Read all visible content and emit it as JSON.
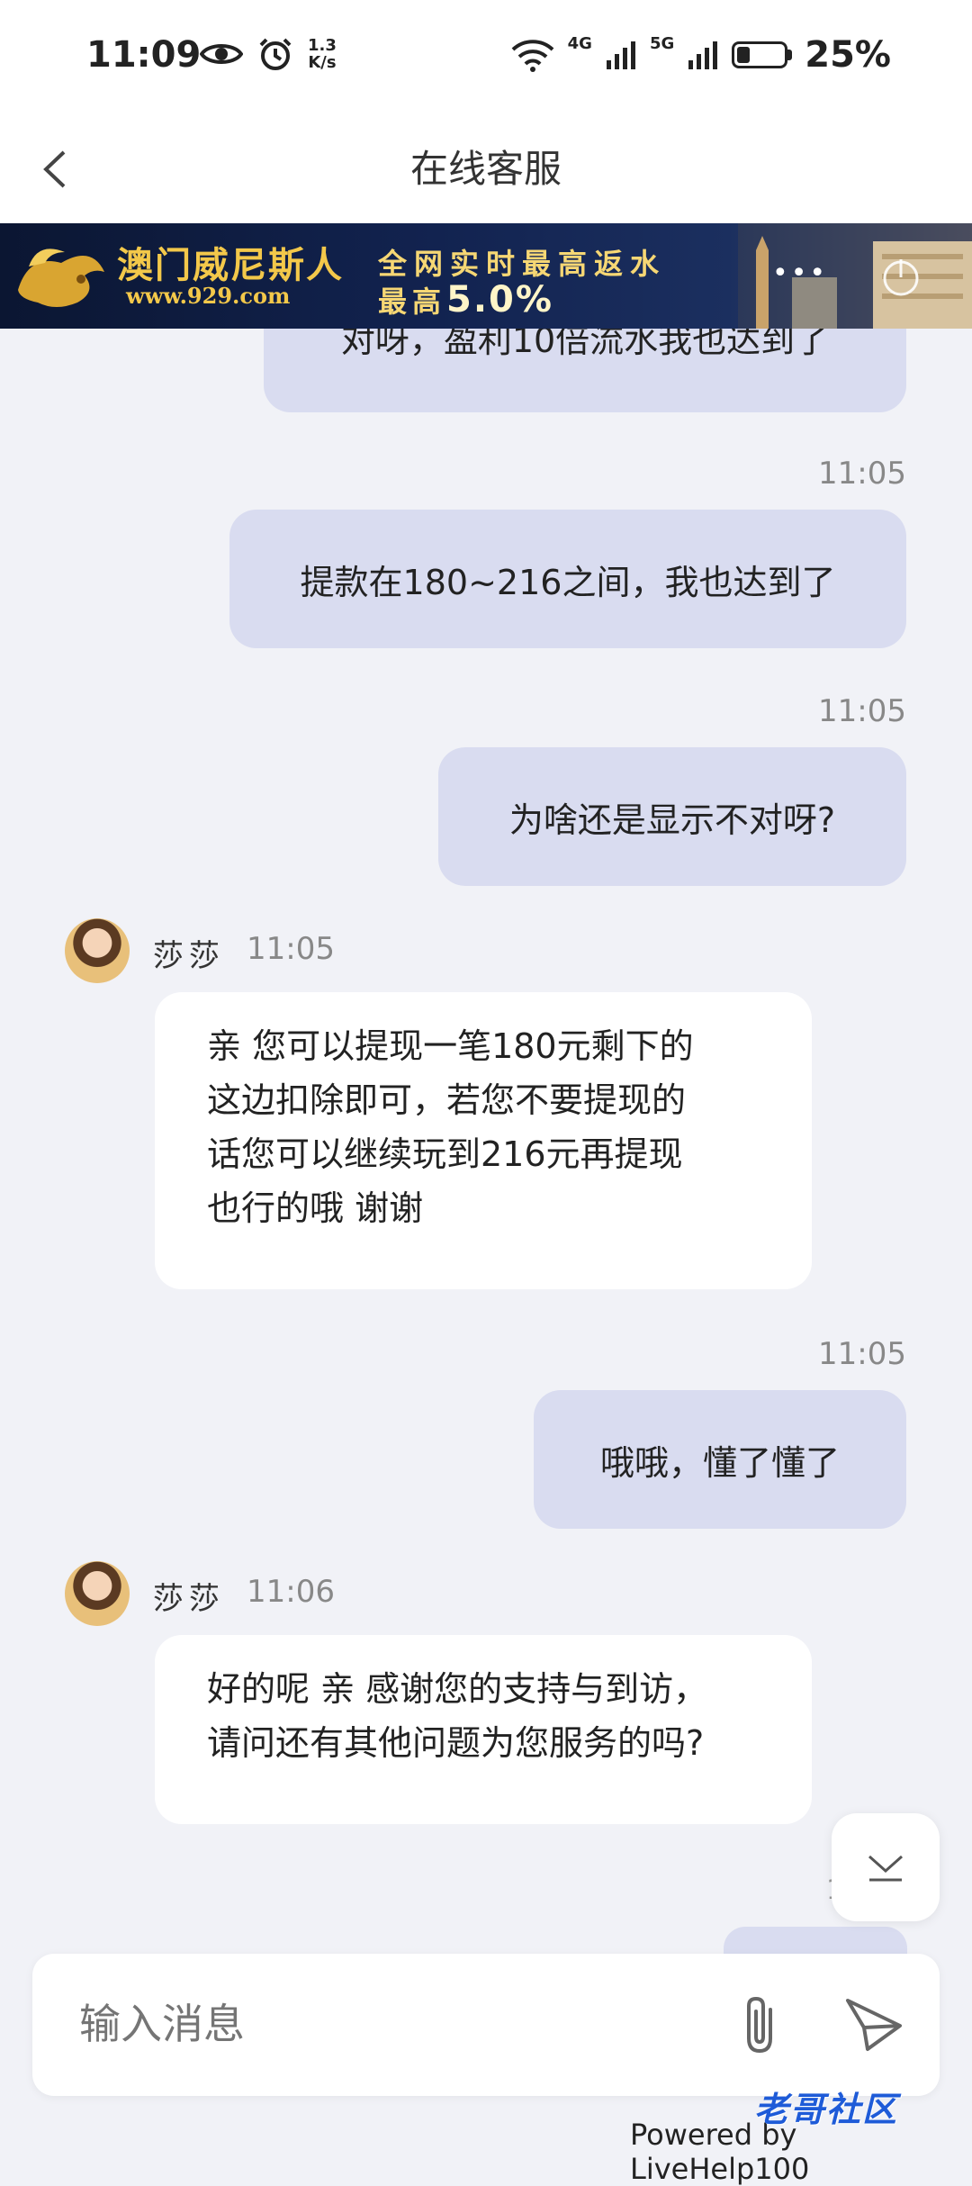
{
  "status_bar": {
    "time": "11:09",
    "speed_value": "1.3",
    "speed_unit": "K/s",
    "net1": "4G",
    "net2": "5G",
    "battery": "25%"
  },
  "header": {
    "title": "在线客服"
  },
  "banner": {
    "brand": "澳门威尼斯人",
    "url": "www.929.com",
    "line1": "全网实时最高返水",
    "line2_prefix": "最高",
    "line2_value": "5.0%",
    "more": "•••"
  },
  "messages": [
    {
      "side": "out",
      "text": "对呀，盈利10倍流水我也达到了"
    },
    {
      "side": "out",
      "time": "11:05",
      "text": "提款在180~216之间，我也达到了"
    },
    {
      "side": "out",
      "time": "11:05",
      "text": "为啥还是显示不对呀?"
    },
    {
      "side": "in",
      "name": "莎莎",
      "time": "11:05",
      "lines": [
        "亲 您可以提现一笔180元剩下的",
        "这边扣除即可，若您不要提现的",
        "话您可以继续玩到216元再提现",
        "也行的哦 谢谢"
      ]
    },
    {
      "side": "out",
      "time": "11:05",
      "text": "哦哦，懂了懂了"
    },
    {
      "side": "in",
      "name": "莎莎",
      "time": "11:06",
      "lines": [
        "好的呢 亲 感谢您的支持与到访，",
        "请问还有其他问题为您服务的吗?"
      ]
    }
  ],
  "partial_time": "1",
  "input": {
    "placeholder": "输入消息"
  },
  "footer": {
    "powered": "Powered by LiveHelp100",
    "watermark": "老哥社区"
  },
  "colors": {
    "outgoing_bubble": "#d9dcf0",
    "incoming_bubble": "#ffffff",
    "background": "#f1f2f7",
    "banner_gold": "#f3c84a"
  }
}
